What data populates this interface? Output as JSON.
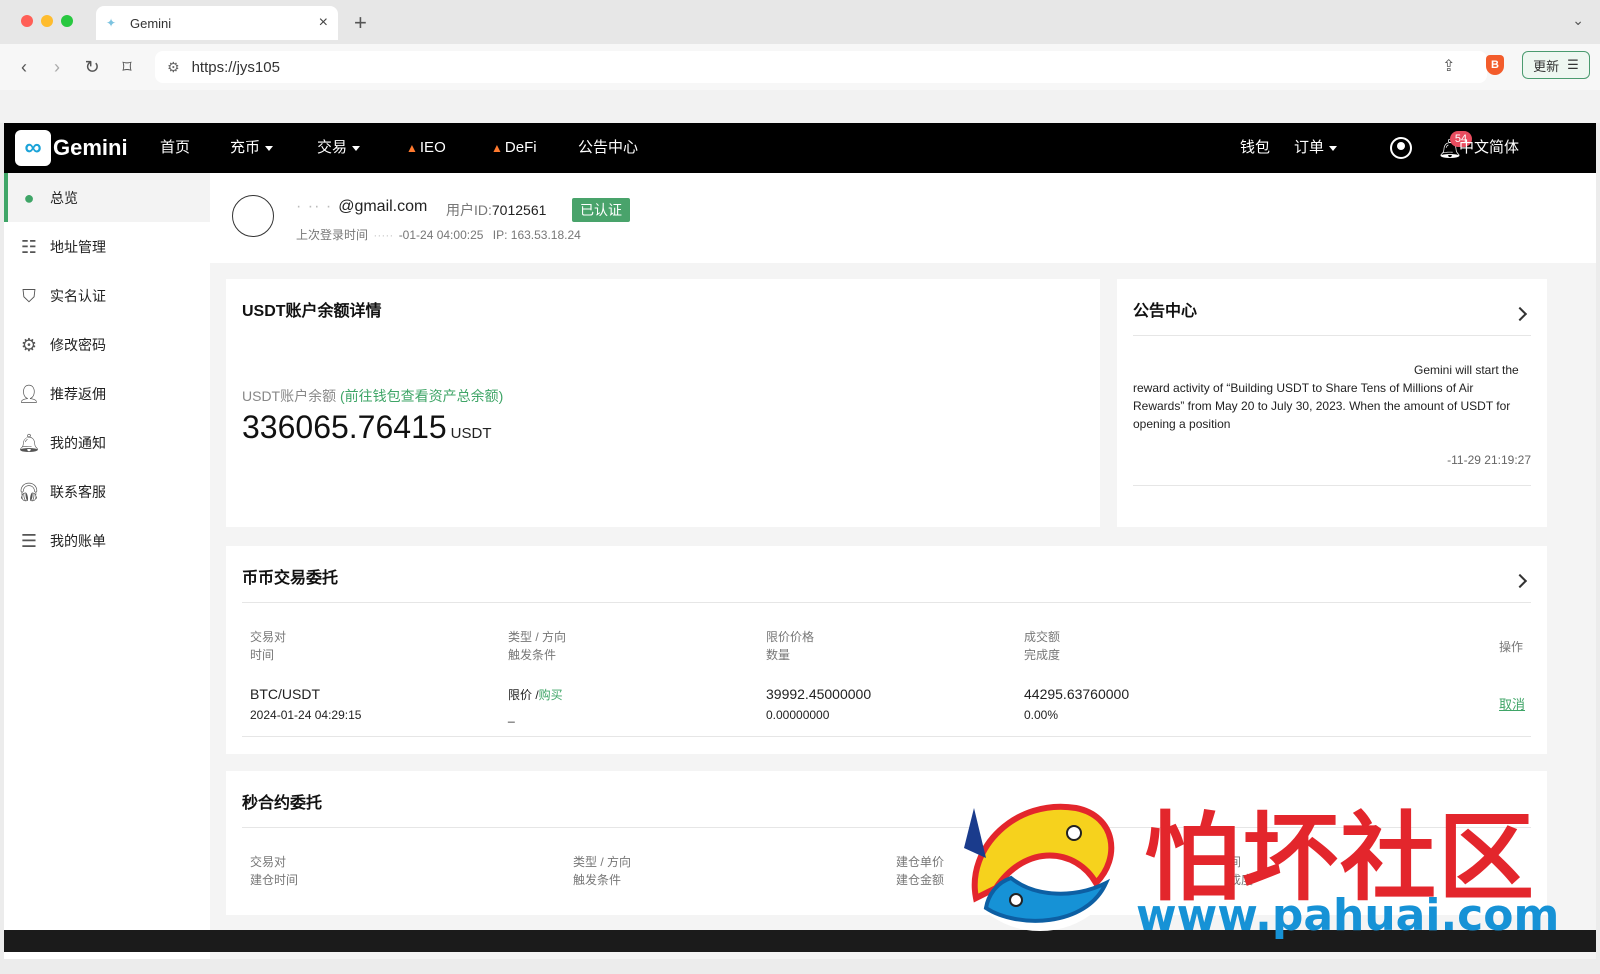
{
  "browser": {
    "tab_title": "Gemini",
    "url": "https://jys105",
    "update_label": "更新"
  },
  "site": {
    "logo_text": "Gemini",
    "nav": {
      "home": "首页",
      "deposit": "充币",
      "trade": "交易",
      "ieo": "IEO",
      "defi": "DeFi",
      "notices": "公告中心",
      "wallet": "钱包",
      "orders": "订单",
      "notification_count": "54",
      "language": "中文简体"
    }
  },
  "sidebar": {
    "items": [
      {
        "label": "总览"
      },
      {
        "label": "地址管理"
      },
      {
        "label": "实名认证"
      },
      {
        "label": "修改密码"
      },
      {
        "label": "推荐返佣"
      },
      {
        "label": "我的通知"
      },
      {
        "label": "联系客服"
      },
      {
        "label": "我的账单"
      }
    ]
  },
  "user": {
    "email_masked": "· ·· ·",
    "email": "@gmail.com",
    "uid_label": "用户ID:",
    "uid": "7012561",
    "verified": "已认证",
    "last_login_label": "上次登录时间",
    "last_login": "-01-24 04:00:25",
    "ip": "IP: 163.53.18.24"
  },
  "balance": {
    "title": "USDT账户余额详情",
    "label": "USDT账户余额",
    "link": "(前往钱包查看资产总余额)",
    "value": "336065.76415",
    "unit": "USDT"
  },
  "announcements": {
    "title": "公告中心",
    "text": "Gemini will start the reward activity of “Building USDT to Share Tens of Millions of Air Rewards” from May 20 to July 30, 2023. When the amount of USDT for opening a position",
    "date": "-11-29 21:19:27"
  },
  "spot_orders": {
    "title": "币币交易委托",
    "headers": {
      "pair": "交易对",
      "time": "时间",
      "type": "类型 / 方向",
      "trigger": "触发条件",
      "price": "限价价格",
      "qty": "数量",
      "amount": "成交额",
      "progress": "完成度",
      "action": "操作"
    },
    "rows": [
      {
        "pair": "BTC/USDT",
        "time": "2024-01-24 04:29:15",
        "type": "限价 /",
        "side": "购买",
        "trigger": "_",
        "price": "39992.45000000",
        "qty": "0.00000000",
        "amount": "44295.63760000",
        "progress": "0.00%",
        "action": "取消"
      }
    ]
  },
  "second_contract": {
    "title": "秒合约委托",
    "headers": {
      "pair": "交易对",
      "open_time": "建仓时间",
      "type": "类型 / 方向",
      "trigger": "触发条件",
      "unit_price": "建仓单价",
      "amount": "建仓金额",
      "time_short": "间",
      "progress_short": "成度"
    }
  },
  "watermark": {
    "cn": "怕坏社区",
    "url": "www.pahuai.com"
  },
  "colors": {
    "accent": "#3fa567",
    "nav_bg": "#000000",
    "badge": "#e84c5f",
    "watermark_red": "#e3262c",
    "watermark_blue": "#1692d6"
  }
}
